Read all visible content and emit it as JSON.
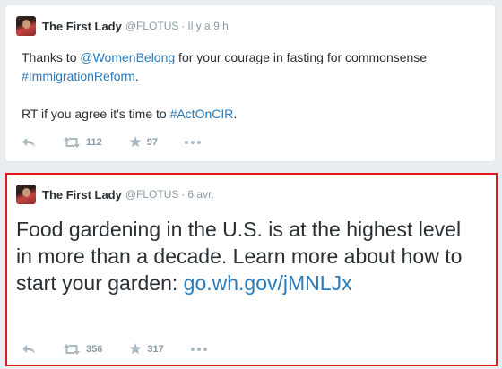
{
  "tweets": [
    {
      "name": "The First Lady",
      "handle": "@FLOTUS",
      "separator": "·",
      "time": "Il y a 9 h",
      "text": {
        "p1_a": "Thanks to ",
        "p1_link": "@WomenBelong",
        "p1_b": " for your courage in fasting for commonsense ",
        "p1_tag": "#ImmigrationReform",
        "p1_end": ".",
        "p2_a": "RT if you agree it's time to ",
        "p2_tag": "#ActOnCIR",
        "p2_end": "."
      },
      "retweets": "112",
      "favorites": "97"
    },
    {
      "name": "The First Lady",
      "handle": "@FLOTUS",
      "separator": "·",
      "time": "6 avr.",
      "text": {
        "body": "Food gardening in the U.S. is at the highest level in more than a decade. Learn more about how to start your garden: ",
        "link": "go.wh.gov/jMNLJx"
      },
      "retweets": "356",
      "favorites": "317"
    }
  ],
  "colors": {
    "link": "#2b7bb9",
    "highlight_border": "#e3161a",
    "icon": "#aab8c2"
  },
  "icons": [
    "reply-icon",
    "retweet-icon",
    "favorite-star-icon",
    "more-dots-icon"
  ]
}
